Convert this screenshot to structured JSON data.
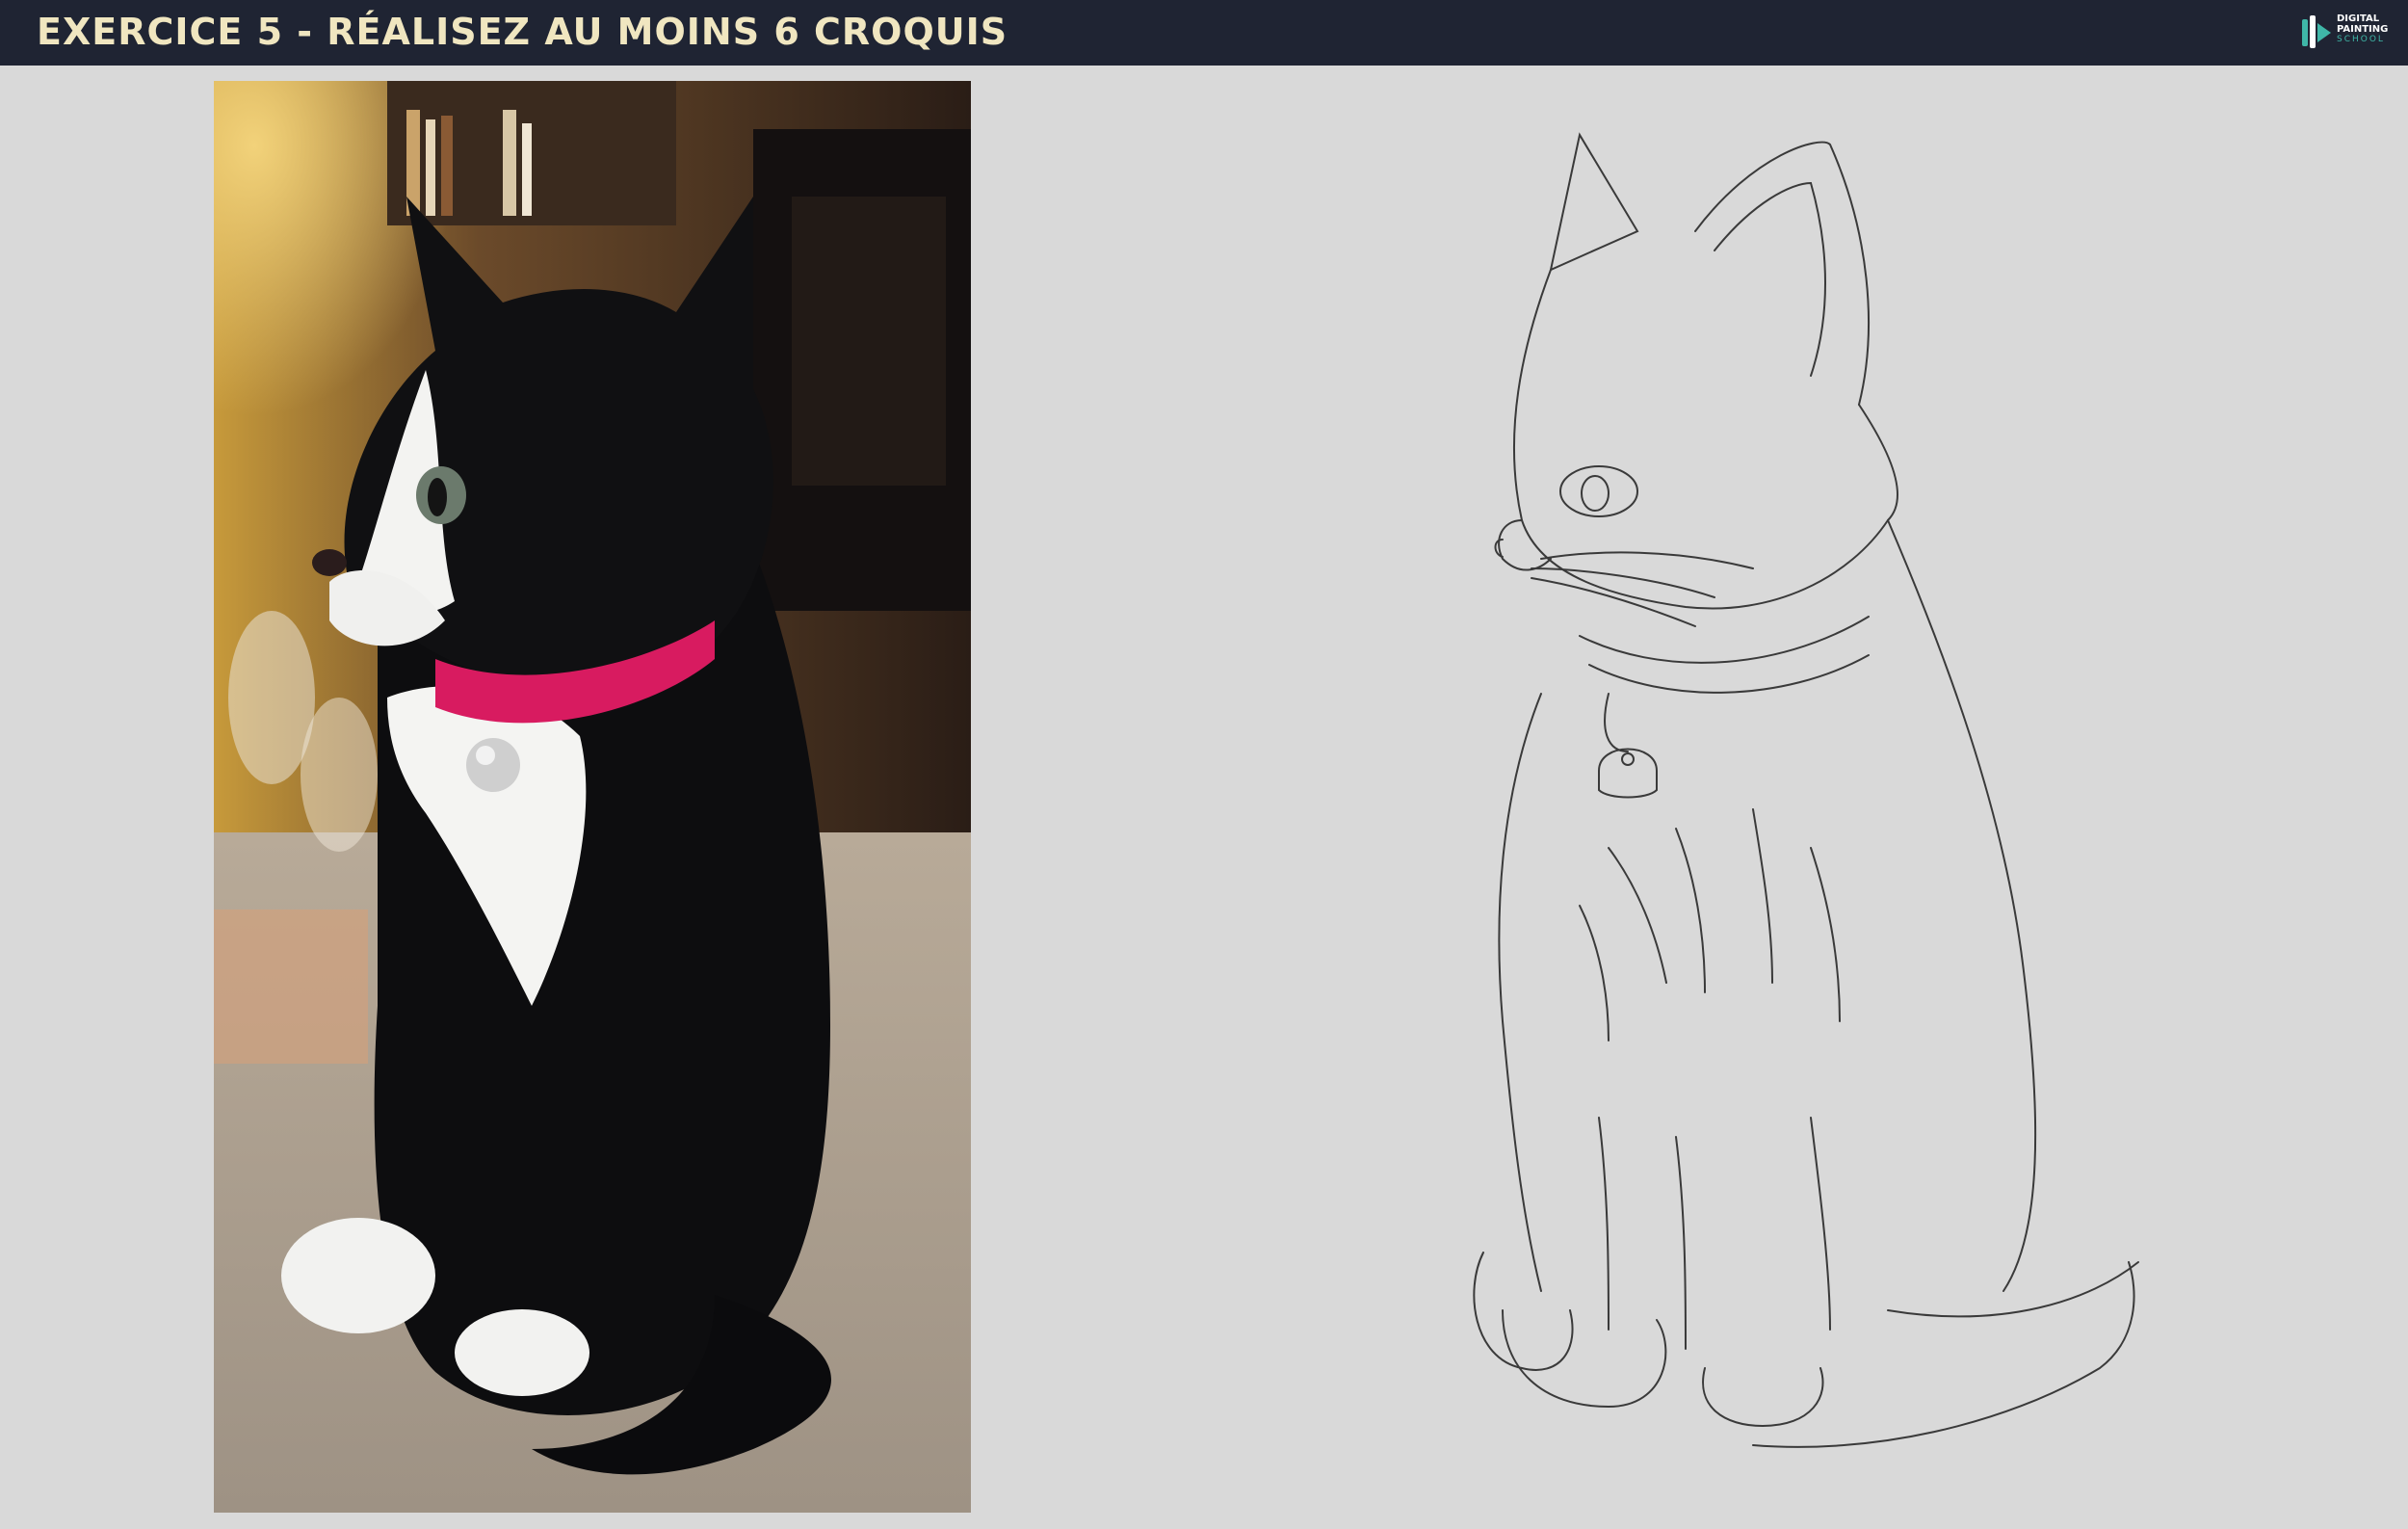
{
  "header": {
    "title": "EXERCICE 5 - RÉALISEZ AU MOINS 6 CROQUIS",
    "logo": {
      "line1": "DIGITAL",
      "line2": "PAINTING",
      "line3": "SCHOOL",
      "icon": "brush-logo-icon"
    }
  },
  "colors": {
    "header_bg": "#1f2433",
    "title_text": "#f0e6c0",
    "canvas_bg": "#d9d9d9",
    "accent": "#3fb7a8",
    "collar": "#d81b60"
  },
  "panels": {
    "photo": {
      "subject": "kitten-photo"
    },
    "sketch": {
      "subject": "kitten-line-sketch"
    }
  }
}
